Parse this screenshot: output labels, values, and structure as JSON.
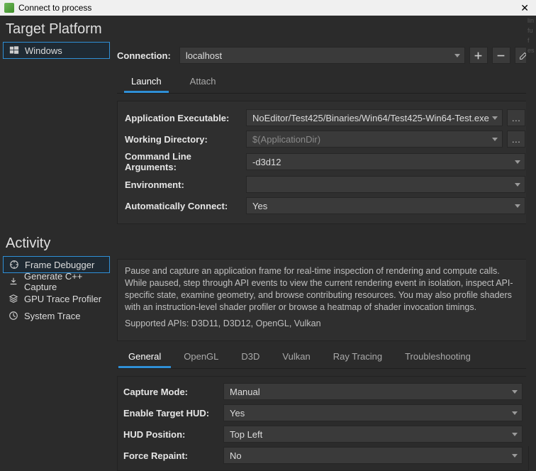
{
  "window": {
    "title": "Connect to process"
  },
  "sections": {
    "target_platform": "Target Platform",
    "activity": "Activity"
  },
  "platforms": [
    {
      "id": "windows",
      "label": "Windows"
    }
  ],
  "connection": {
    "label": "Connection:",
    "value": "localhost"
  },
  "launch_tabs": [
    {
      "id": "launch",
      "label": "Launch",
      "active": true
    },
    {
      "id": "attach",
      "label": "Attach",
      "active": false
    }
  ],
  "launch_form": {
    "app_exe_label": "Application Executable:",
    "app_exe_value": "NoEditor/Test425/Binaries/Win64/Test425-Win64-Test.exe",
    "workdir_label": "Working Directory:",
    "workdir_value": "$(ApplicationDir)",
    "args_label": "Command Line Arguments:",
    "args_value": "-d3d12",
    "env_label": "Environment:",
    "env_value": "",
    "autoconnect_label": "Automatically Connect:",
    "autoconnect_value": "Yes"
  },
  "activities": [
    {
      "id": "frame-debugger",
      "label": "Frame Debugger",
      "icon": "frame"
    },
    {
      "id": "generate-cpp-capture",
      "label": "Generate C++ Capture",
      "icon": "download"
    },
    {
      "id": "gpu-trace-profiler",
      "label": "GPU Trace Profiler",
      "icon": "layers"
    },
    {
      "id": "system-trace",
      "label": "System Trace",
      "icon": "clock"
    }
  ],
  "activity_desc": {
    "body": "Pause and capture an application frame for real-time inspection of rendering and compute calls. While paused, step through API events to view the current rendering event in isolation, inspect API-specific state, examine geometry, and browse contributing resources. You may also profile shaders with an instruction-level shader profiler or browse a heatmap of shader invocation timings.",
    "apis": "Supported APIs: D3D11, D3D12, OpenGL, Vulkan"
  },
  "capture_tabs": [
    {
      "id": "general",
      "label": "General",
      "active": true
    },
    {
      "id": "opengl",
      "label": "OpenGL",
      "active": false
    },
    {
      "id": "d3d",
      "label": "D3D",
      "active": false
    },
    {
      "id": "vulkan",
      "label": "Vulkan",
      "active": false
    },
    {
      "id": "raytracing",
      "label": "Ray Tracing",
      "active": false
    },
    {
      "id": "troubleshooting",
      "label": "Troubleshooting",
      "active": false
    }
  ],
  "capture_settings": {
    "capture_mode_label": "Capture Mode:",
    "capture_mode_value": "Manual",
    "enable_hud_label": "Enable Target HUD:",
    "enable_hud_value": "Yes",
    "hud_pos_label": "HUD Position:",
    "hud_pos_value": "Top Left",
    "force_repaint_label": "Force Repaint:",
    "force_repaint_value": "No"
  }
}
